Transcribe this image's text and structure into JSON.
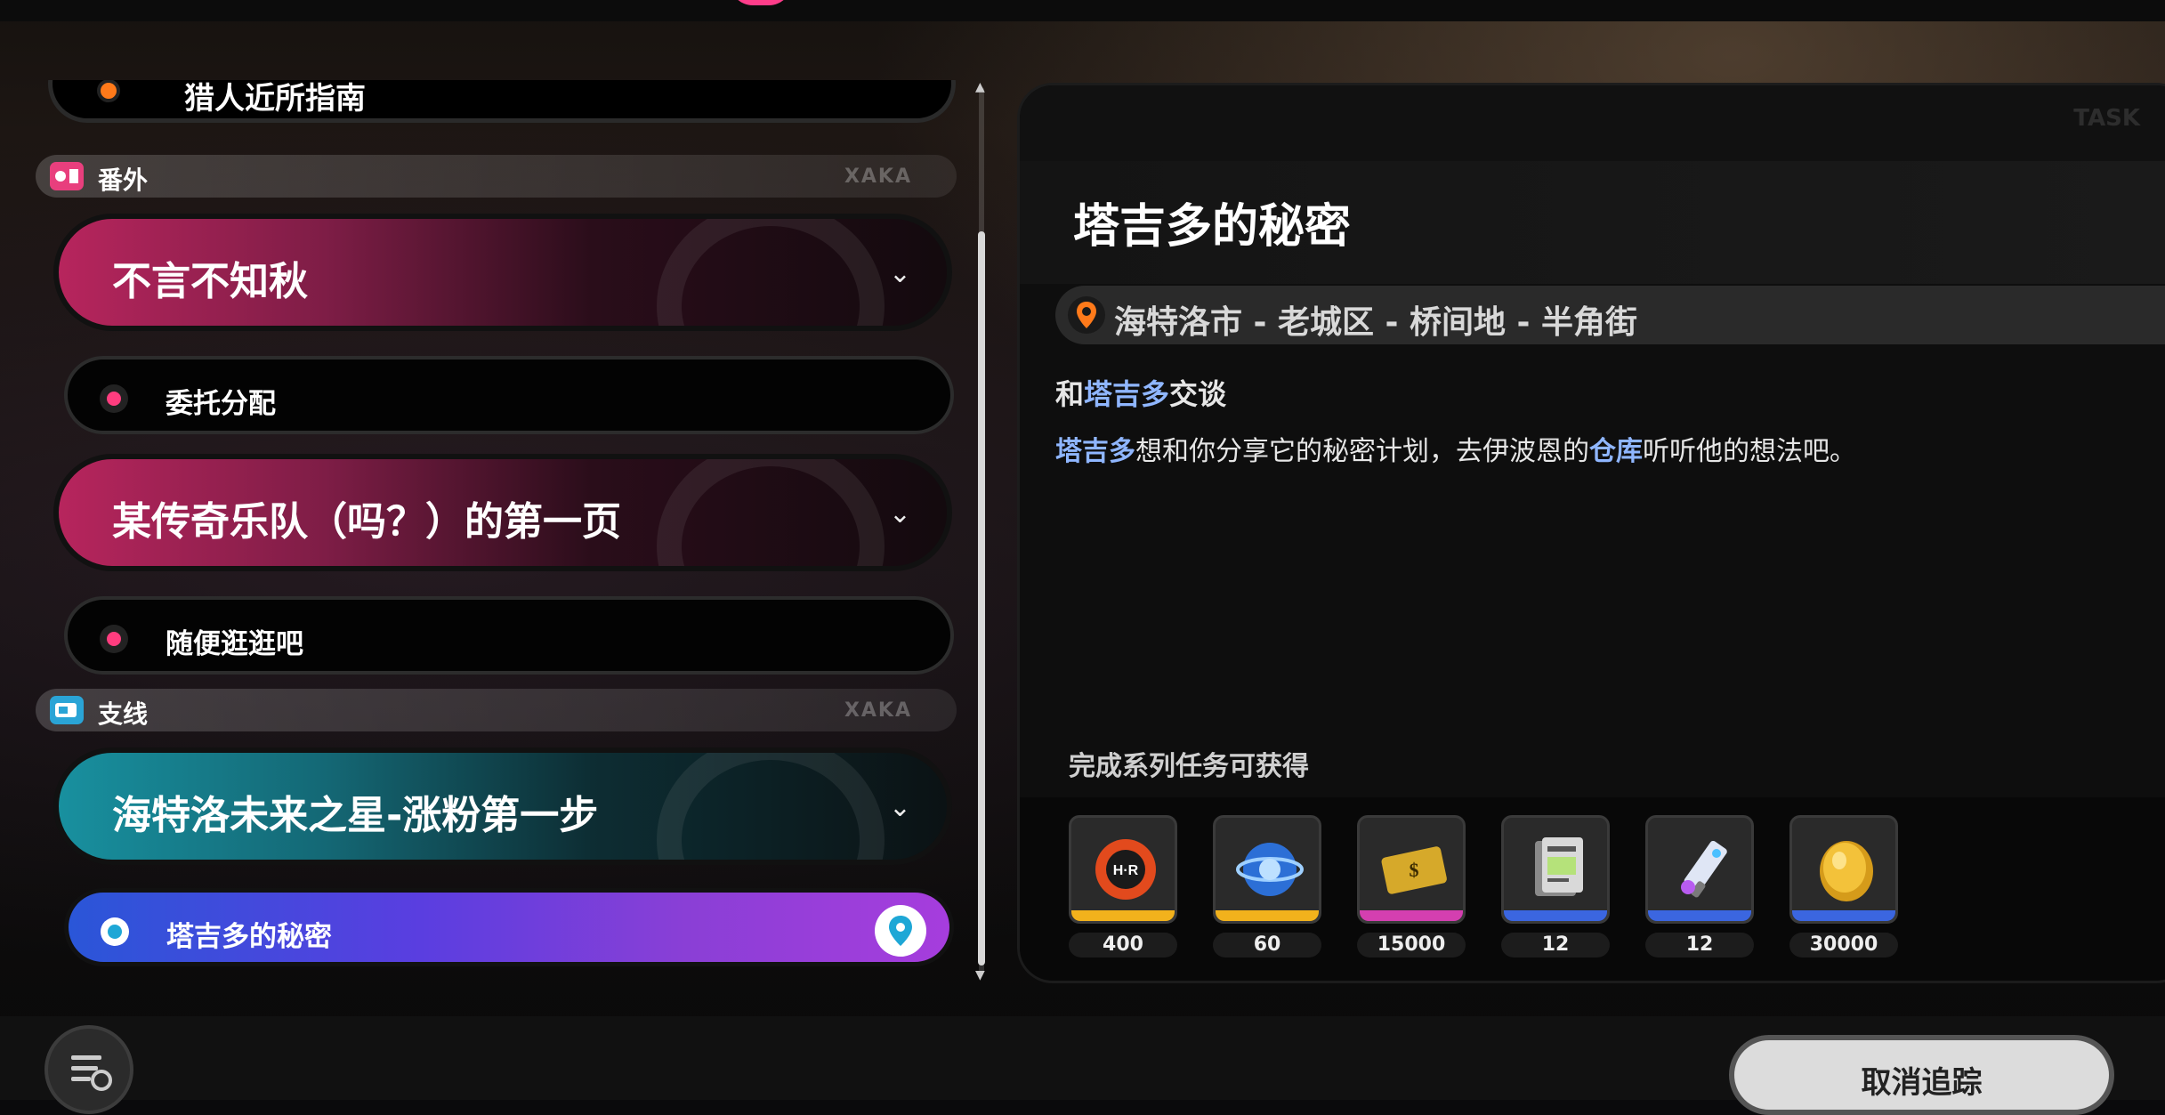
{
  "list": {
    "first_item": "猎人近所指南",
    "categories": [
      {
        "label": "番外",
        "tag": "XAKA",
        "color": "#e83f7d",
        "groups": [
          {
            "title": "不言不知秋",
            "sub": "委托分配"
          },
          {
            "title": "某传奇乐队（吗？）的第一页",
            "sub": "随便逛逛吧"
          }
        ]
      },
      {
        "label": "支线",
        "tag": "XAKA",
        "color": "#2aa4d6",
        "groups": [
          {
            "title": "海特洛未来之星-涨粉第一步",
            "sub": "塔吉多的秘密"
          }
        ]
      }
    ]
  },
  "detail": {
    "header_tag": "TASK",
    "title": "塔吉多的秘密",
    "location": "海特洛市 - 老城区 - 桥间地 - 半角街",
    "objective_prefix": "和",
    "objective_highlight": "塔吉多",
    "objective_suffix": "交谈",
    "desc_hl1": "塔吉多",
    "desc_mid": "想和你分享它的秘密计划，去伊波恩的",
    "desc_hl2": "仓库",
    "desc_end": "听听他的想法吧。",
    "reward_label": "完成系列任务可获得",
    "rewards": [
      {
        "name": "hunter-badge-icon",
        "count": "400",
        "rarity": "#f2b21c"
      },
      {
        "name": "blue-orb-icon",
        "count": "60",
        "rarity": "#f2b21c"
      },
      {
        "name": "gold-card-icon",
        "count": "15000",
        "rarity": "#d43fb0"
      },
      {
        "name": "document-card-icon",
        "count": "12",
        "rarity": "#3b66e0"
      },
      {
        "name": "paint-tube-icon",
        "count": "12",
        "rarity": "#3b66e0"
      },
      {
        "name": "gold-coin-icon",
        "count": "30000",
        "rarity": "#3b66e0"
      }
    ]
  },
  "footer": {
    "untrack_button": "取消追踪"
  }
}
